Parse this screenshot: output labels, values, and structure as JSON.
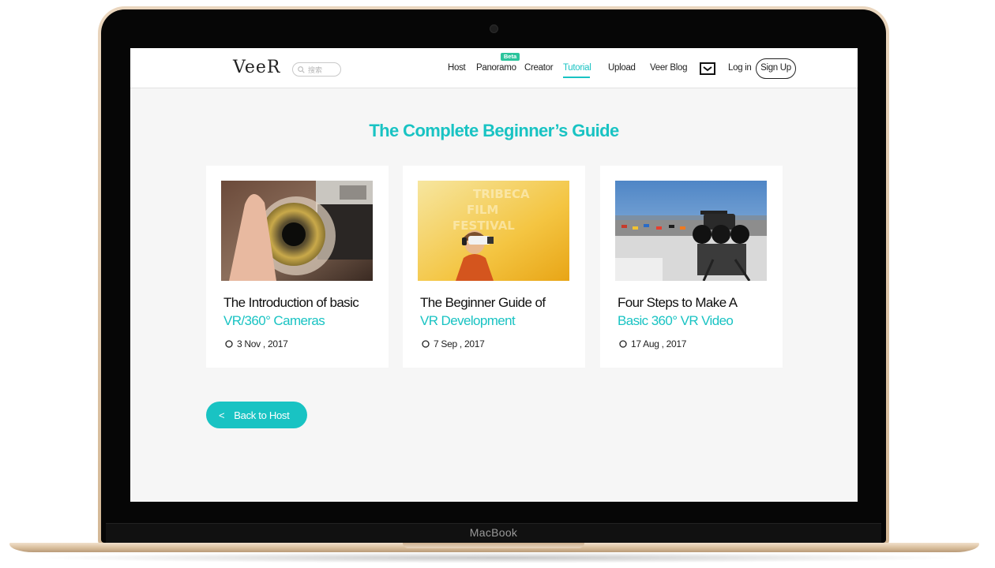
{
  "device": {
    "brand_label": "MacBook"
  },
  "navbar": {
    "logo_text": "VeeR",
    "search_placeholder": "搜索",
    "items": [
      {
        "label": "Host"
      },
      {
        "label": "Panoramo",
        "badge": "Beta"
      },
      {
        "label": "Creator"
      },
      {
        "label": "Tutorial",
        "active": true
      },
      {
        "label": "Upload"
      },
      {
        "label": "Veer Blog"
      }
    ],
    "login_label": "Log in",
    "signup_label": "Sign Up"
  },
  "main": {
    "title": "The Complete Beginner’s Guide",
    "cards": [
      {
        "line1": "The Introduction of basic",
        "line2": "VR/360° Cameras",
        "date": "3 Nov , 2017",
        "image": "camera-lens-photo"
      },
      {
        "line1": "The Beginner Guide of",
        "line2": "VR Development",
        "date": "7 Sep , 2017",
        "image": "vr-headset-photo",
        "image_text": [
          "TRIBECA",
          "FILM",
          "FESTIVAL"
        ]
      },
      {
        "line1": "Four Steps to Make A",
        "line2": "Basic 360° VR Video",
        "date": "17 Aug , 2017",
        "image": "race-track-camera-photo"
      }
    ],
    "back_button_label": "Back to Host",
    "back_button_icon": "chevron-left-icon"
  },
  "colors": {
    "accent": "#19c3c3",
    "beta": "#2bc49c",
    "page_bg": "#f6f6f6"
  }
}
